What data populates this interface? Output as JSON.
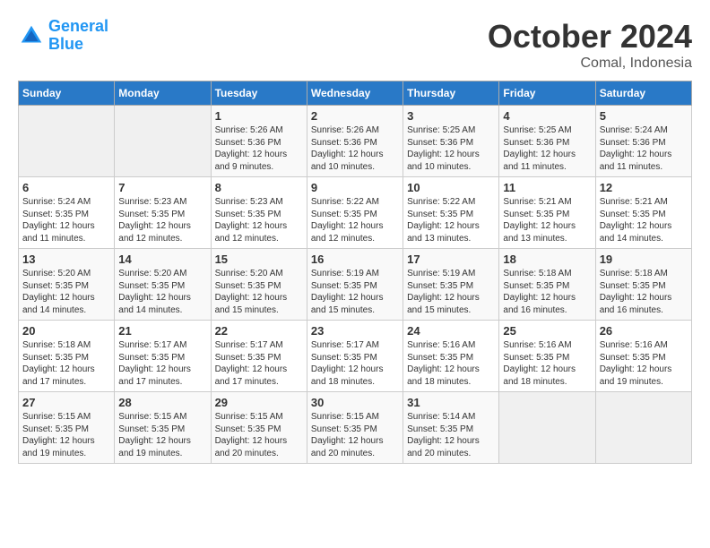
{
  "logo": {
    "line1": "General",
    "line2": "Blue"
  },
  "title": "October 2024",
  "subtitle": "Comal, Indonesia",
  "days_header": [
    "Sunday",
    "Monday",
    "Tuesday",
    "Wednesday",
    "Thursday",
    "Friday",
    "Saturday"
  ],
  "weeks": [
    [
      {
        "day": "",
        "info": ""
      },
      {
        "day": "",
        "info": ""
      },
      {
        "day": "1",
        "info": "Sunrise: 5:26 AM\nSunset: 5:36 PM\nDaylight: 12 hours\nand 9 minutes."
      },
      {
        "day": "2",
        "info": "Sunrise: 5:26 AM\nSunset: 5:36 PM\nDaylight: 12 hours\nand 10 minutes."
      },
      {
        "day": "3",
        "info": "Sunrise: 5:25 AM\nSunset: 5:36 PM\nDaylight: 12 hours\nand 10 minutes."
      },
      {
        "day": "4",
        "info": "Sunrise: 5:25 AM\nSunset: 5:36 PM\nDaylight: 12 hours\nand 11 minutes."
      },
      {
        "day": "5",
        "info": "Sunrise: 5:24 AM\nSunset: 5:36 PM\nDaylight: 12 hours\nand 11 minutes."
      }
    ],
    [
      {
        "day": "6",
        "info": "Sunrise: 5:24 AM\nSunset: 5:35 PM\nDaylight: 12 hours\nand 11 minutes."
      },
      {
        "day": "7",
        "info": "Sunrise: 5:23 AM\nSunset: 5:35 PM\nDaylight: 12 hours\nand 12 minutes."
      },
      {
        "day": "8",
        "info": "Sunrise: 5:23 AM\nSunset: 5:35 PM\nDaylight: 12 hours\nand 12 minutes."
      },
      {
        "day": "9",
        "info": "Sunrise: 5:22 AM\nSunset: 5:35 PM\nDaylight: 12 hours\nand 12 minutes."
      },
      {
        "day": "10",
        "info": "Sunrise: 5:22 AM\nSunset: 5:35 PM\nDaylight: 12 hours\nand 13 minutes."
      },
      {
        "day": "11",
        "info": "Sunrise: 5:21 AM\nSunset: 5:35 PM\nDaylight: 12 hours\nand 13 minutes."
      },
      {
        "day": "12",
        "info": "Sunrise: 5:21 AM\nSunset: 5:35 PM\nDaylight: 12 hours\nand 14 minutes."
      }
    ],
    [
      {
        "day": "13",
        "info": "Sunrise: 5:20 AM\nSunset: 5:35 PM\nDaylight: 12 hours\nand 14 minutes."
      },
      {
        "day": "14",
        "info": "Sunrise: 5:20 AM\nSunset: 5:35 PM\nDaylight: 12 hours\nand 14 minutes."
      },
      {
        "day": "15",
        "info": "Sunrise: 5:20 AM\nSunset: 5:35 PM\nDaylight: 12 hours\nand 15 minutes."
      },
      {
        "day": "16",
        "info": "Sunrise: 5:19 AM\nSunset: 5:35 PM\nDaylight: 12 hours\nand 15 minutes."
      },
      {
        "day": "17",
        "info": "Sunrise: 5:19 AM\nSunset: 5:35 PM\nDaylight: 12 hours\nand 15 minutes."
      },
      {
        "day": "18",
        "info": "Sunrise: 5:18 AM\nSunset: 5:35 PM\nDaylight: 12 hours\nand 16 minutes."
      },
      {
        "day": "19",
        "info": "Sunrise: 5:18 AM\nSunset: 5:35 PM\nDaylight: 12 hours\nand 16 minutes."
      }
    ],
    [
      {
        "day": "20",
        "info": "Sunrise: 5:18 AM\nSunset: 5:35 PM\nDaylight: 12 hours\nand 17 minutes."
      },
      {
        "day": "21",
        "info": "Sunrise: 5:17 AM\nSunset: 5:35 PM\nDaylight: 12 hours\nand 17 minutes."
      },
      {
        "day": "22",
        "info": "Sunrise: 5:17 AM\nSunset: 5:35 PM\nDaylight: 12 hours\nand 17 minutes."
      },
      {
        "day": "23",
        "info": "Sunrise: 5:17 AM\nSunset: 5:35 PM\nDaylight: 12 hours\nand 18 minutes."
      },
      {
        "day": "24",
        "info": "Sunrise: 5:16 AM\nSunset: 5:35 PM\nDaylight: 12 hours\nand 18 minutes."
      },
      {
        "day": "25",
        "info": "Sunrise: 5:16 AM\nSunset: 5:35 PM\nDaylight: 12 hours\nand 18 minutes."
      },
      {
        "day": "26",
        "info": "Sunrise: 5:16 AM\nSunset: 5:35 PM\nDaylight: 12 hours\nand 19 minutes."
      }
    ],
    [
      {
        "day": "27",
        "info": "Sunrise: 5:15 AM\nSunset: 5:35 PM\nDaylight: 12 hours\nand 19 minutes."
      },
      {
        "day": "28",
        "info": "Sunrise: 5:15 AM\nSunset: 5:35 PM\nDaylight: 12 hours\nand 19 minutes."
      },
      {
        "day": "29",
        "info": "Sunrise: 5:15 AM\nSunset: 5:35 PM\nDaylight: 12 hours\nand 20 minutes."
      },
      {
        "day": "30",
        "info": "Sunrise: 5:15 AM\nSunset: 5:35 PM\nDaylight: 12 hours\nand 20 minutes."
      },
      {
        "day": "31",
        "info": "Sunrise: 5:14 AM\nSunset: 5:35 PM\nDaylight: 12 hours\nand 20 minutes."
      },
      {
        "day": "",
        "info": ""
      },
      {
        "day": "",
        "info": ""
      }
    ]
  ]
}
